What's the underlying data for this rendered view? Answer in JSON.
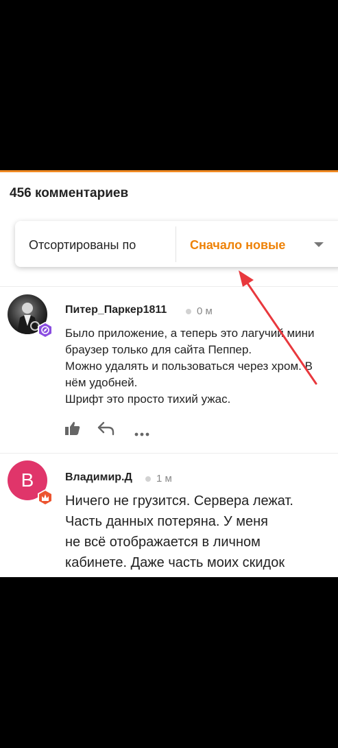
{
  "comments_header": {
    "count_label": "456 комментариев"
  },
  "sort": {
    "label": "Отсортированы по",
    "value": "Сначало новые"
  },
  "comments": [
    {
      "author": "Питер_Паркер1811",
      "time": "0 м",
      "avatar_icon": "user-photo-icon",
      "badge_icon": "compass-badge-icon",
      "lines": [
        "Было приложение, а теперь это лагучий мини",
        "браузер только для сайта Пеппер.",
        "Можно удалять и пользоваться через хром. В",
        "нём удобней.",
        "Шрифт это просто тихий ужас."
      ]
    },
    {
      "author": "Владимир.Д",
      "time": "1 м",
      "avatar_letter": "В",
      "badge_icon": "flame-badge-icon",
      "lines": [
        "Ничего не грузится. Сервера лежат.",
        "Часть данных потеряна. У меня",
        "не всё отображается в личном",
        "кабинете. Даже часть моих скидок"
      ]
    }
  ],
  "actions": {
    "like_icon": "thumbs-up-icon",
    "reply_icon": "reply-arrow-icon",
    "more_icon": "more-dots-icon"
  },
  "annotation": {
    "arrow_color": "#e8383d"
  },
  "colors": {
    "accent": "#ee8208",
    "divider_top": "#f08a24"
  }
}
